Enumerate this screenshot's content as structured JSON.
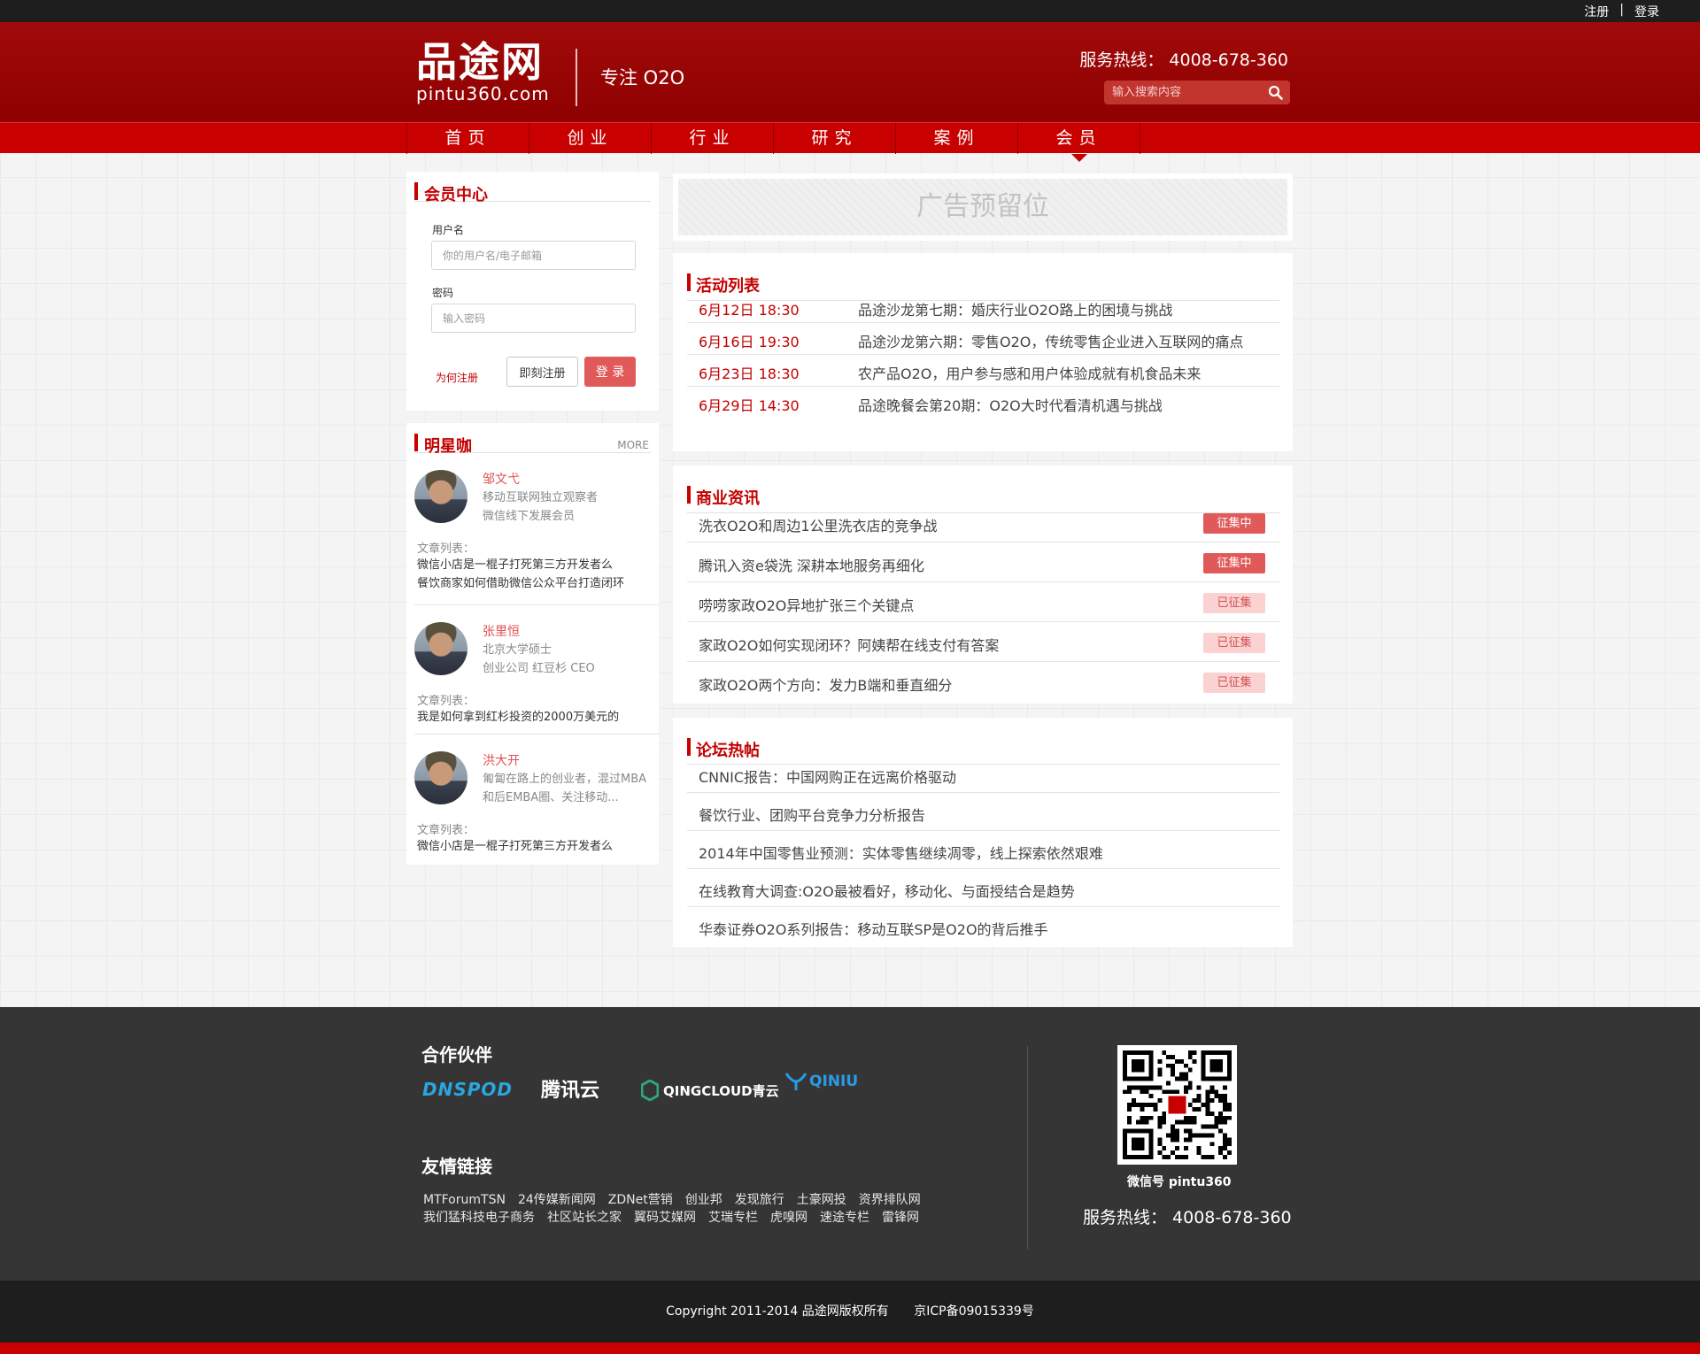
{
  "topbar": {
    "register": "注册",
    "sep": "|",
    "login": "登录"
  },
  "header": {
    "logo_cn": "品途网",
    "logo_en": "pintu360.com",
    "slogan": "专注 O2O",
    "hotline": "服务热线： 4008-678-360",
    "search_placeholder": "输入搜索内容"
  },
  "nav": [
    {
      "label": "首页"
    },
    {
      "label": "创业"
    },
    {
      "label": "行业"
    },
    {
      "label": "研究"
    },
    {
      "label": "案例"
    },
    {
      "label": "会员",
      "active": true
    }
  ],
  "member": {
    "title": "会员中心",
    "username_label": "用户名",
    "username_placeholder": "你的用户名/电子邮箱",
    "password_label": "密码",
    "password_placeholder": "输入密码",
    "why_link": "为何注册",
    "register_btn": "即刻注册",
    "login_btn": "登 录"
  },
  "stars": {
    "title": "明星咖",
    "more": "MORE",
    "articles_label": "文章列表：",
    "items": [
      {
        "name": "邹文弋",
        "desc": "移动互联网独立观察者\n微信线下发展会员",
        "articles": "微信小店是一棍子打死第三方开发者么\n餐饮商家如何借助微信公众平台打造闭环"
      },
      {
        "name": "张里恒",
        "desc": "北京大学硕士\n创业公司 红豆杉 CEO",
        "articles": "我是如何拿到红杉投资的2000万美元的"
      },
      {
        "name": "洪大开",
        "desc": "匍匐在路上的创业者，混过MBA和后EMBA圈、关注移动...",
        "articles": "微信小店是一棍子打死第三方开发者么"
      }
    ]
  },
  "ad": {
    "text": "广告预留位"
  },
  "events": {
    "title": "活动列表",
    "items": [
      {
        "date": "6月12日 18:30",
        "title": "品途沙龙第七期：婚庆行业O2O路上的困境与挑战"
      },
      {
        "date": "6月16日 19:30",
        "title": "品途沙龙第六期：零售O2O，传统零售企业进入互联网的痛点"
      },
      {
        "date": "6月23日 18:30",
        "title": "农产品O2O，用户参与感和用户体验成就有机食品未来"
      },
      {
        "date": "6月29日 14:30",
        "title": "品途晚餐会第20期：O2O大时代看清机遇与挑战"
      }
    ]
  },
  "business": {
    "title": "商业资讯",
    "items": [
      {
        "title": "洗衣O2O和周边1公里洗衣店的竞争战",
        "badge": "征集中",
        "status": "on"
      },
      {
        "title": "腾讯入资e袋洗 深耕本地服务再细化",
        "badge": "征集中",
        "status": "on"
      },
      {
        "title": "唠唠家政O2O异地扩张三个关键点",
        "badge": "已征集",
        "status": "off"
      },
      {
        "title": "家政O2O如何实现闭环？阿姨帮在线支付有答案",
        "badge": "已征集",
        "status": "off"
      },
      {
        "title": "家政O2O两个方向：发力B端和垂直细分",
        "badge": "已征集",
        "status": "off"
      }
    ]
  },
  "forum": {
    "title": "论坛热帖",
    "items": [
      {
        "title": "CNNIC报告：中国网购正在远离价格驱动"
      },
      {
        "title": "餐饮行业、团购平台竞争力分析报告"
      },
      {
        "title": "2014年中国零售业预测：实体零售继续凋零，线上探索依然艰难"
      },
      {
        "title": "在线教育大调查:O2O最被看好，移动化、与面授结合是趋势"
      },
      {
        "title": "华泰证券O2O系列报告：移动互联SP是O2O的背后推手"
      }
    ]
  },
  "footer": {
    "partners_title": "合作伙伴",
    "partners": [
      "DNSPOD",
      "腾讯云",
      "QINGCLOUD青云",
      "QINIU"
    ],
    "links_title": "友情链接",
    "links_row1": [
      "MTForumTSN",
      "24传媒新闻网",
      "ZDNet营销",
      "创业邦",
      "发现旅行",
      "土豪网投",
      "资界排队网"
    ],
    "links_row2": [
      "我们猛科技电子商务",
      "社区站长之家",
      "翼码艾媒网",
      "艾瑞专栏",
      "虎嗅网",
      "速途专栏",
      "雷锋网"
    ],
    "qr_label": "微信号 pintu360",
    "hotline": "服务热线： 4008-678-360"
  },
  "copyright": {
    "text": "Copyright 2011-2014 品途网版权所有",
    "icp": "京ICP备09015339号"
  },
  "colors": {
    "brand_red": "#c80000",
    "header_red": "#9a0606",
    "footer_dark": "#353535",
    "accent_badge": "#e05a5a"
  }
}
